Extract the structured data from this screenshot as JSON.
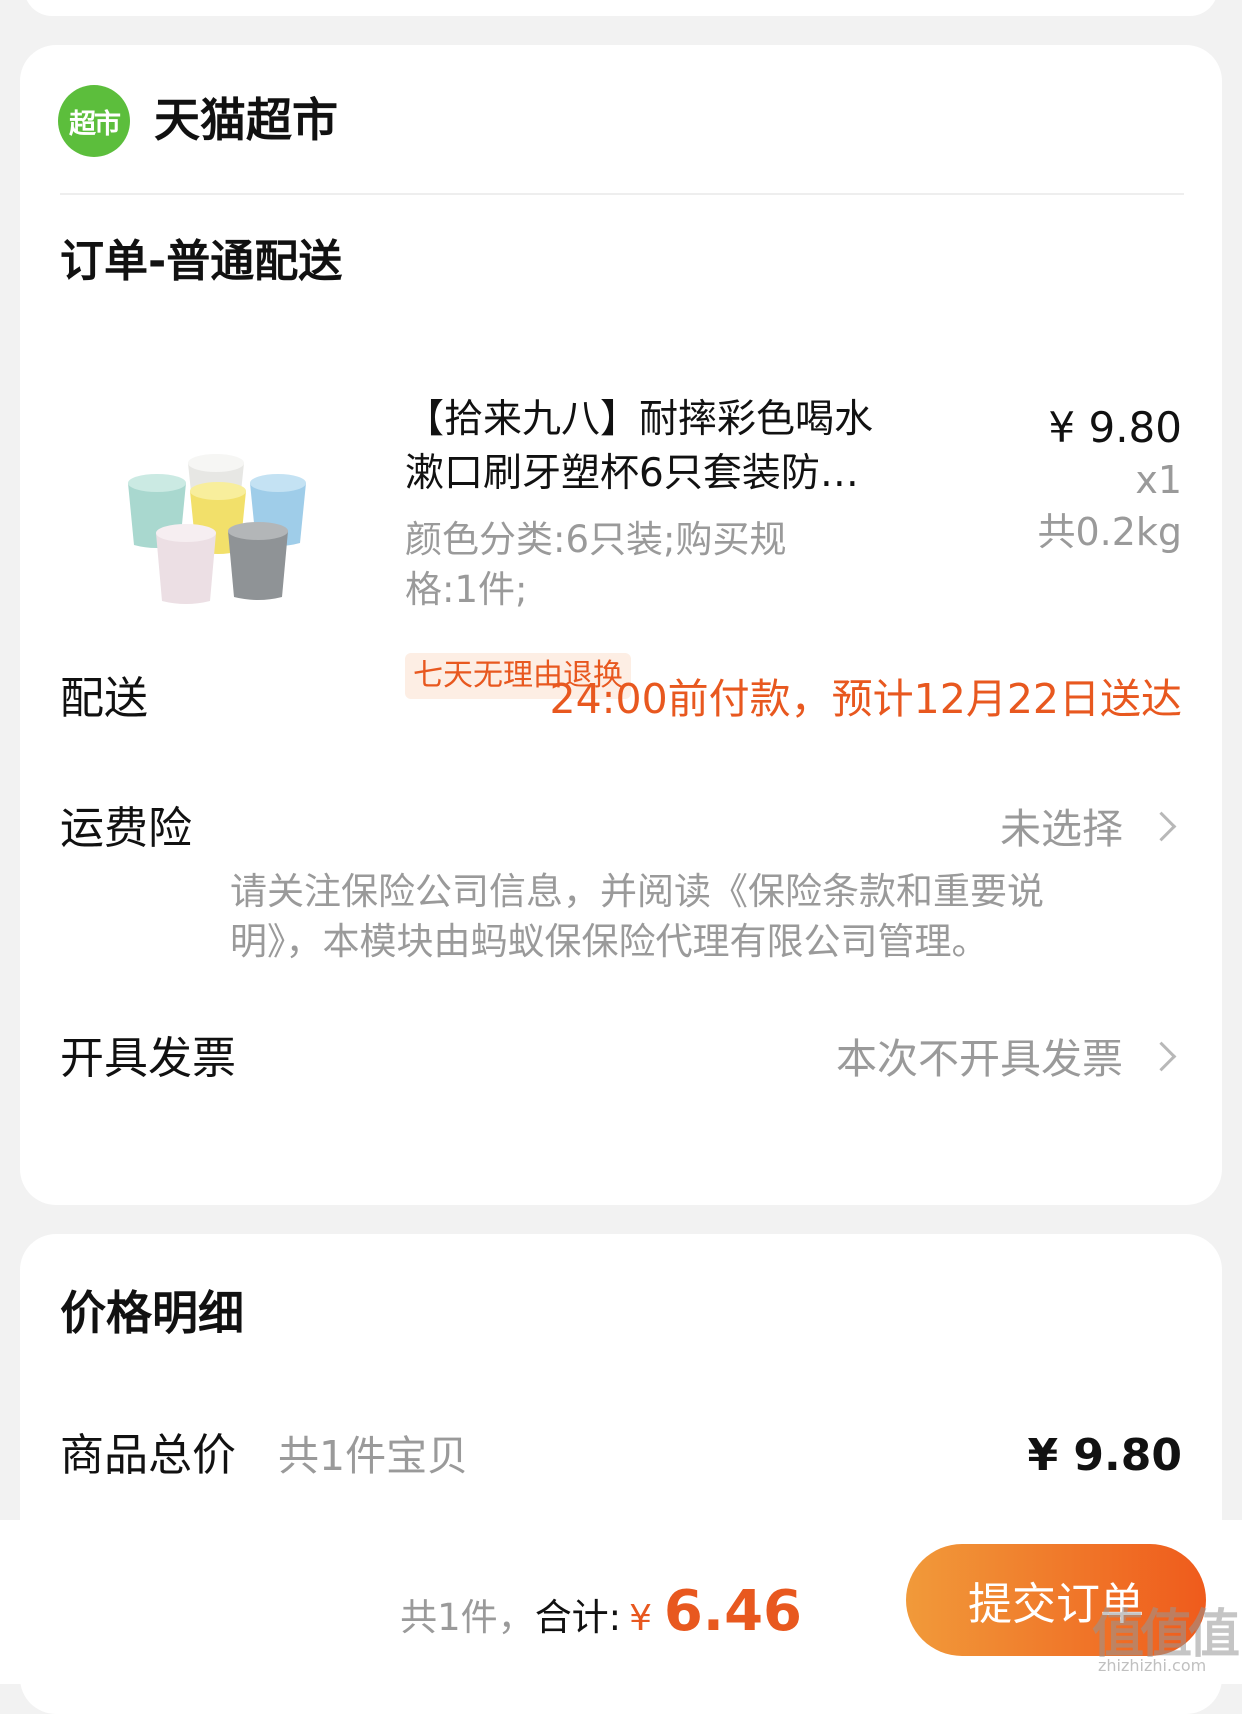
{
  "store": {
    "logo_text": "超市",
    "name": "天猫超市",
    "order_title": "订单-普通配送"
  },
  "product": {
    "title_line1": "【拾来九八】耐摔彩色喝水",
    "title_line2": "漱口刷牙塑杯6只套装防…",
    "sku_line1": "颜色分类:6只装;购买规",
    "sku_line2": "格:1件;",
    "price": "¥ 9.80",
    "quantity": "x1",
    "weight": "共0.2kg",
    "tag": "七天无理由退换"
  },
  "delivery": {
    "label": "配送",
    "value": "24:00前付款，预计12月22日送达"
  },
  "insurance": {
    "label": "运费险",
    "value": "未选择",
    "note_line1": "请关注保险公司信息，并阅读《保险条款和重要说",
    "note_line2": "明》，本模块由蚂蚁保保险代理有限公司管理。"
  },
  "invoice": {
    "label": "开具发票",
    "value": "本次不开具发票"
  },
  "price_detail": {
    "title": "价格明细",
    "total_label": "商品总价",
    "total_sub": "共1件宝贝",
    "total_value": "¥ 9.80"
  },
  "bottom": {
    "count": "共1件，",
    "total_label": "合计:",
    "currency": "¥",
    "amount": "6.46",
    "submit": "提交订单"
  },
  "watermark": {
    "logo": "值值值",
    "url": "zhizhizhi.com"
  },
  "colors": {
    "accent": "#e8581f",
    "logo_green": "#5cbe3c",
    "muted": "#9a9a9a"
  },
  "icons": [
    "store-logo-icon",
    "chevron-right-icon"
  ]
}
